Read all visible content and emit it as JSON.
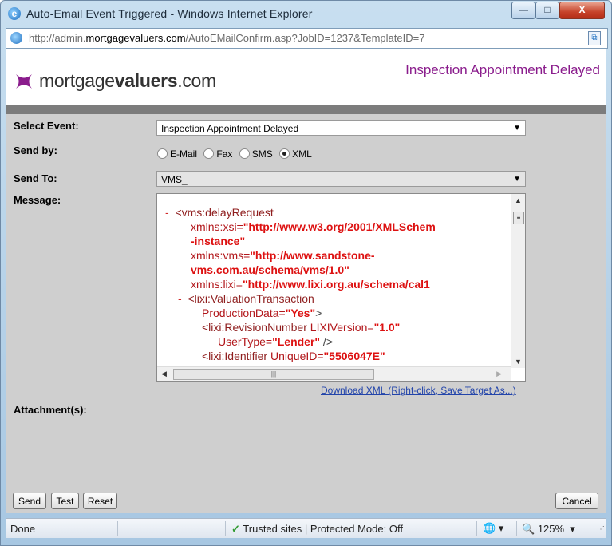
{
  "window": {
    "title": "Auto-Email Event Triggered - Windows Internet Explorer",
    "min_label": "—",
    "max_label": "□",
    "close_label": "X"
  },
  "address": {
    "url_prefix": "http://admin.",
    "url_domain": "mortgagevaluers.com",
    "url_suffix": "/AutoEMailConfirm.asp?JobID=1237&TemplateID=7"
  },
  "header": {
    "logo_plain": "mortgage",
    "logo_bold": "valuers",
    "logo_tail": ".com",
    "title": "Inspection Appointment Delayed",
    "brand_color": "#8a1c8c"
  },
  "form": {
    "select_event_label": "Select Event:",
    "select_event_value": "Inspection Appointment Delayed",
    "send_by_label": "Send by:",
    "send_by_options": [
      {
        "label": "E-Mail",
        "checked": false
      },
      {
        "label": "Fax",
        "checked": false
      },
      {
        "label": "SMS",
        "checked": false
      },
      {
        "label": "XML",
        "checked": true
      }
    ],
    "send_to_label": "Send To:",
    "send_to_value": "VMS_",
    "message_label": "Message:",
    "attachments_label": "Attachment(s):",
    "download_link": "Download XML (Right-click, Save Target As...)"
  },
  "xml_lines": [
    {
      "minus": "-",
      "tag": "<vms:delayRequest",
      "attr": "",
      "val": "",
      "rest": ""
    },
    {
      "minus": "",
      "tag": "",
      "attr": "xmlns:xsi=",
      "val": "\"http://www.w3.org/2001/XMLSchem",
      "rest": ""
    },
    {
      "minus": "",
      "tag": "",
      "attr": "",
      "val": "-instance\"",
      "rest": ""
    },
    {
      "minus": "",
      "tag": "",
      "attr": "xmlns:vms=",
      "val": "\"http://www.sandstone-",
      "rest": ""
    },
    {
      "minus": "",
      "tag": "",
      "attr": "",
      "val": "vms.com.au/schema/vms/1.0\"",
      "rest": ""
    },
    {
      "minus": "",
      "tag": "",
      "attr": "xmlns:lixi=",
      "val": "\"http://www.lixi.org.au/schema/cal1",
      "rest": ""
    },
    {
      "minus": "-",
      "tag": "<lixi:ValuationTransaction",
      "attr": "",
      "val": "",
      "rest": ""
    },
    {
      "minus": "",
      "tag": "",
      "attr": "ProductionData=",
      "val": "\"Yes\"",
      "rest": ">"
    },
    {
      "minus": "",
      "tag": "<lixi:RevisionNumber",
      "attr": " LIXIVersion=",
      "val": "\"1.0\"",
      "rest": ""
    },
    {
      "minus": "",
      "tag": "",
      "attr": "UserType=",
      "val": "\"Lender\"",
      "rest": " />"
    },
    {
      "minus": "",
      "tag": "<lixi:Identifier",
      "attr": " UniqueID=",
      "val": "\"5506047E\"",
      "rest": ""
    }
  ],
  "buttons": {
    "send": "Send",
    "test": "Test",
    "reset": "Reset",
    "cancel": "Cancel"
  },
  "status": {
    "done": "Done",
    "zone": "Trusted sites | Protected Mode: Off",
    "zoom": "125%"
  }
}
